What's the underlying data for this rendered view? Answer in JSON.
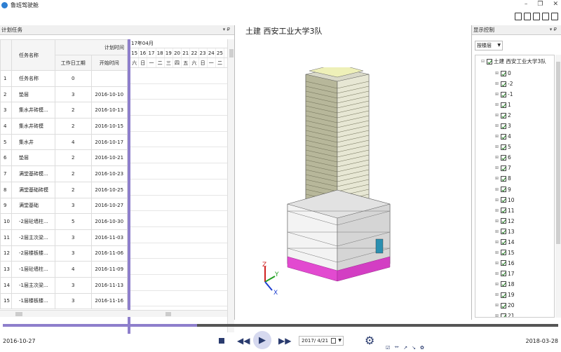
{
  "window": {
    "title": "鲁班驾驶舱",
    "minimize": "–",
    "restore": "❐",
    "close": "✕"
  },
  "left_panel": {
    "title": "计划任务",
    "pin": "▾ ₽",
    "columns": {
      "name": "任务名称",
      "plan_group": "计划时间",
      "duration": "工作日工期",
      "start": "开始时间"
    },
    "tasks": [
      {
        "idx": "1",
        "name": "任务名称",
        "duration": "0",
        "start": ""
      },
      {
        "idx": "2",
        "name": "垫层",
        "duration": "3",
        "start": "2016-10-10"
      },
      {
        "idx": "3",
        "name": "集水井砖模...",
        "duration": "2",
        "start": "2016-10-13"
      },
      {
        "idx": "4",
        "name": "集水井砖模",
        "duration": "2",
        "start": "2016-10-15"
      },
      {
        "idx": "5",
        "name": "集水井",
        "duration": "4",
        "start": "2016-10-17"
      },
      {
        "idx": "6",
        "name": "垫层",
        "duration": "2",
        "start": "2016-10-21"
      },
      {
        "idx": "7",
        "name": "满堂基砖模...",
        "duration": "2",
        "start": "2016-10-23"
      },
      {
        "idx": "8",
        "name": "满堂基础砖模",
        "duration": "2",
        "start": "2016-10-25"
      },
      {
        "idx": "9",
        "name": "满堂基础",
        "duration": "3",
        "start": "2016-10-27"
      },
      {
        "idx": "10",
        "name": "-2层砼墙柱...",
        "duration": "5",
        "start": "2016-10-30"
      },
      {
        "idx": "11",
        "name": "-2层主次梁...",
        "duration": "3",
        "start": "2016-11-03"
      },
      {
        "idx": "12",
        "name": "-2层楼板楼...",
        "duration": "3",
        "start": "2016-11-06"
      },
      {
        "idx": "13",
        "name": "-1层砼墙柱...",
        "duration": "4",
        "start": "2016-11-09"
      },
      {
        "idx": "14",
        "name": "-1层主次梁...",
        "duration": "3",
        "start": "2016-11-13"
      },
      {
        "idx": "15",
        "name": "-1层楼板楼...",
        "duration": "3",
        "start": "2016-11-16"
      }
    ],
    "gantt": {
      "month": "17年04月",
      "days": [
        "15",
        "16",
        "17",
        "18",
        "19",
        "20",
        "21",
        "22",
        "23",
        "24",
        "25"
      ],
      "weekdays": [
        "六",
        "日",
        "一",
        "二",
        "三",
        "四",
        "五",
        "六",
        "日",
        "一",
        "二"
      ]
    }
  },
  "center": {
    "project_title": "土建 西安工业大学3队",
    "axis": {
      "z": "Z",
      "y": "Y",
      "x": "X"
    }
  },
  "right_panel": {
    "title": "显示控制",
    "pin": "▾ ₽",
    "filter": "按楼层",
    "tree_root": "土建 西安工业大学3队",
    "floors": [
      "0",
      "-2",
      "-1",
      "1",
      "2",
      "3",
      "4",
      "5",
      "6",
      "7",
      "8",
      "9",
      "10",
      "11",
      "12",
      "13",
      "14",
      "15",
      "16",
      "17",
      "18",
      "19",
      "20",
      "21"
    ]
  },
  "playback": {
    "start_date": "2016-10-27",
    "end_date": "2018-03-28",
    "current_date": "2017/ 4/21",
    "progress": 0.35,
    "mini_tools": [
      "☑",
      "艹",
      "↗",
      "↘",
      "✿"
    ]
  }
}
